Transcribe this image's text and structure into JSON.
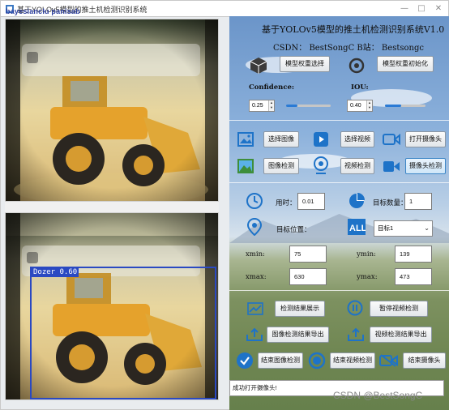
{
  "window": {
    "title": "基于YOLOv5模型的推土机检测识别系统",
    "overlay_tag": "bayesianclu panisab",
    "minimize": "—",
    "maximize": "□",
    "close": "✕"
  },
  "header": {
    "title": "基于YOLOv5模型的推土机检测识别系统V1.0",
    "credits": "CSDN：  BestSongC    B站：  Bestsongc"
  },
  "model": {
    "select_label": "模型权重选择",
    "init_label": "模型权重初始化"
  },
  "thresholds": {
    "confidence_label": "Confidence:",
    "confidence_value": "0.25",
    "confidence_level": 0.25,
    "iou_label": "IOU:",
    "iou_value": "0.40",
    "iou_level": 0.4
  },
  "media": {
    "select_image": "选择图像",
    "select_video": "选择视频",
    "open_camera": "打开摄像头",
    "image_detect": "图像检测",
    "video_detect": "视频检测",
    "camera_detect": "摄像头检测"
  },
  "results": {
    "time_label": "用时：",
    "time_value": "0.01",
    "target_count_label": "目标数量：",
    "target_count_value": "1",
    "target_position_label": "目标位置：",
    "target_select": "目标1",
    "xmin_label": "xmin:",
    "xmin_value": "75",
    "ymin_label": "ymin:",
    "ymin_value": "139",
    "xmax_label": "xmax:",
    "xmax_value": "630",
    "ymax_label": "ymax:",
    "ymax_value": "473"
  },
  "actions": {
    "show_results": "检测结果展示",
    "pause_video": "暂停视频检测",
    "export_image": "图像检测结果导出",
    "export_video": "视频检测结果导出",
    "end_image": "结束图像检测",
    "end_video": "结束视频检测",
    "end_camera": "结束摄像头"
  },
  "detection": {
    "label": "Dozer 0.60"
  },
  "status": {
    "message": "成功打开摄像头!"
  },
  "watermark": "CSDN @BestSongC",
  "colors": {
    "accent_blue": "#2a7ad5",
    "detection_box": "#2a49c2"
  }
}
